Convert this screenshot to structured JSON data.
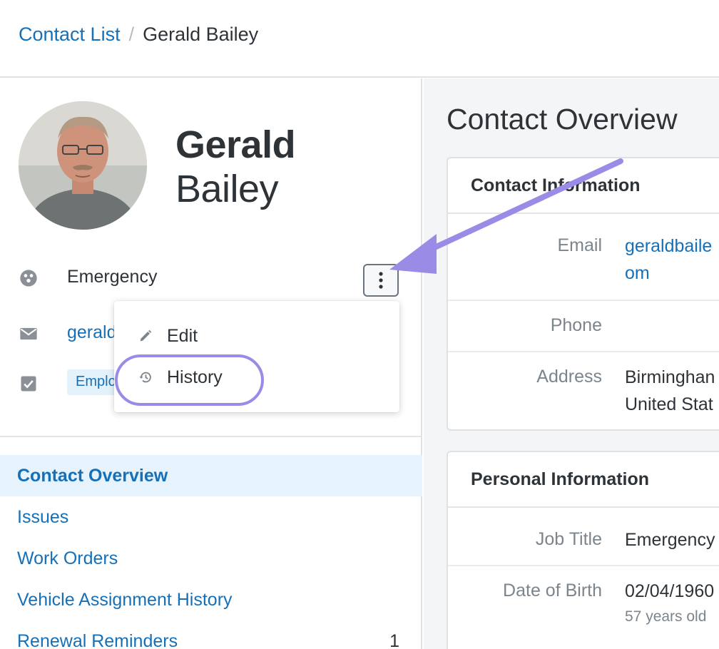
{
  "breadcrumb": {
    "parent": "Contact List",
    "separator": "/",
    "current": "Gerald Bailey"
  },
  "contact": {
    "first_name": "Gerald",
    "last_name": "Bailey",
    "group": "Emergency",
    "email_partial": "gerald",
    "tag_partial": "Emplo"
  },
  "actions_menu": {
    "items": [
      {
        "label": "Edit",
        "icon": "pencil-icon"
      },
      {
        "label": "History",
        "icon": "history-icon"
      }
    ]
  },
  "nav": {
    "items": [
      {
        "label": "Contact Overview",
        "active": true,
        "count": ""
      },
      {
        "label": "Issues",
        "active": false,
        "count": ""
      },
      {
        "label": "Work Orders",
        "active": false,
        "count": ""
      },
      {
        "label": "Vehicle Assignment History",
        "active": false,
        "count": ""
      },
      {
        "label": "Renewal Reminders",
        "active": false,
        "count": "1"
      }
    ]
  },
  "overview": {
    "title": "Contact Overview",
    "contact_info": {
      "heading": "Contact Information",
      "email_label": "Email",
      "email_value_line1": "geraldbaile",
      "email_value_line2": "om",
      "phone_label": "Phone",
      "phone_value": "",
      "address_label": "Address",
      "address_line1": "Birminghan",
      "address_line2": "United Stat"
    },
    "personal_info": {
      "heading": "Personal Information",
      "job_title_label": "Job Title",
      "job_title_value": "Emergency",
      "dob_label": "Date of Birth",
      "dob_value": "02/04/1960",
      "age_note": "57 years old"
    }
  },
  "colors": {
    "link": "#1670b8",
    "active_nav_bg": "#e7f3fc",
    "annotation": "#9a8be6",
    "tag_bg": "#e4f2fb"
  }
}
